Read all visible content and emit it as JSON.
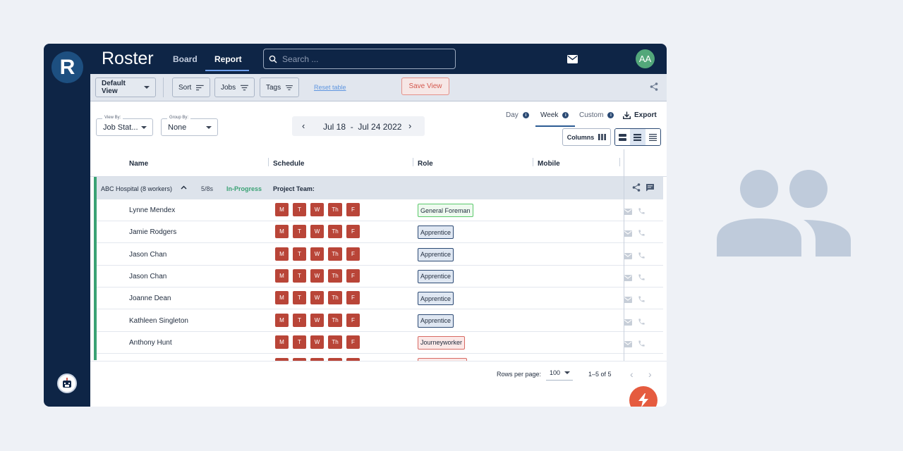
{
  "app": {
    "logo_letter": "R",
    "title": "Roster",
    "nav": [
      {
        "label": "Board"
      },
      {
        "label": "Report"
      }
    ],
    "search_placeholder": "Search ...",
    "user_initials": "AA"
  },
  "toolbar": {
    "default_view": "Default View",
    "sort": "Sort",
    "jobs": "Jobs",
    "tags": "Tags",
    "reset_table": "Reset table",
    "save_view": "Save View"
  },
  "filters": {
    "view_by": {
      "label": "View By:",
      "value": "Job Stat..."
    },
    "group_by": {
      "label": "Group By:",
      "value": "None"
    }
  },
  "date_nav": {
    "start": "Jul 18",
    "separator": "-",
    "end": "Jul 24 2022"
  },
  "view_tabs": [
    {
      "label": "Day"
    },
    {
      "label": "Week"
    },
    {
      "label": "Custom"
    }
  ],
  "export_label": "Export",
  "columns_label": "Columns",
  "table": {
    "columns": [
      "Name",
      "Schedule",
      "Role",
      "Mobile"
    ],
    "group": {
      "name": "ABC Hospital (8 workers)",
      "count": "5/8s",
      "status": "In-Progress",
      "team_label": "Project Team:"
    },
    "days": [
      "M",
      "T",
      "W",
      "Th",
      "F"
    ],
    "rows": [
      {
        "name": "Lynne Mendex",
        "role": "General Foreman"
      },
      {
        "name": "Jamie Rodgers",
        "role": "Apprentice"
      },
      {
        "name": "Jason Chan",
        "role": "Apprentice"
      },
      {
        "name": "Jason Chan",
        "role": "Apprentice"
      },
      {
        "name": "Joanne Dean",
        "role": "Apprentice"
      },
      {
        "name": "Kathleen Singleton",
        "role": "Apprentice"
      },
      {
        "name": "Anthony Hunt",
        "role": "Journeyworker"
      }
    ]
  },
  "pagination": {
    "rows_per_page_label": "Rows per page:",
    "rows_per_page": "100",
    "range": "1–5 of 5"
  },
  "colors": {
    "navy": "#0e2546",
    "day_chip": "#b94538",
    "in_progress": "#3aa274",
    "save_view": "#d4584e",
    "fab": "#e55b3f"
  },
  "icons": [
    "mail-icon",
    "gear-icon",
    "search-icon",
    "filter-icon",
    "share-icon",
    "chat-icon",
    "phone-icon",
    "download-icon",
    "lightning-icon",
    "people-icon"
  ]
}
